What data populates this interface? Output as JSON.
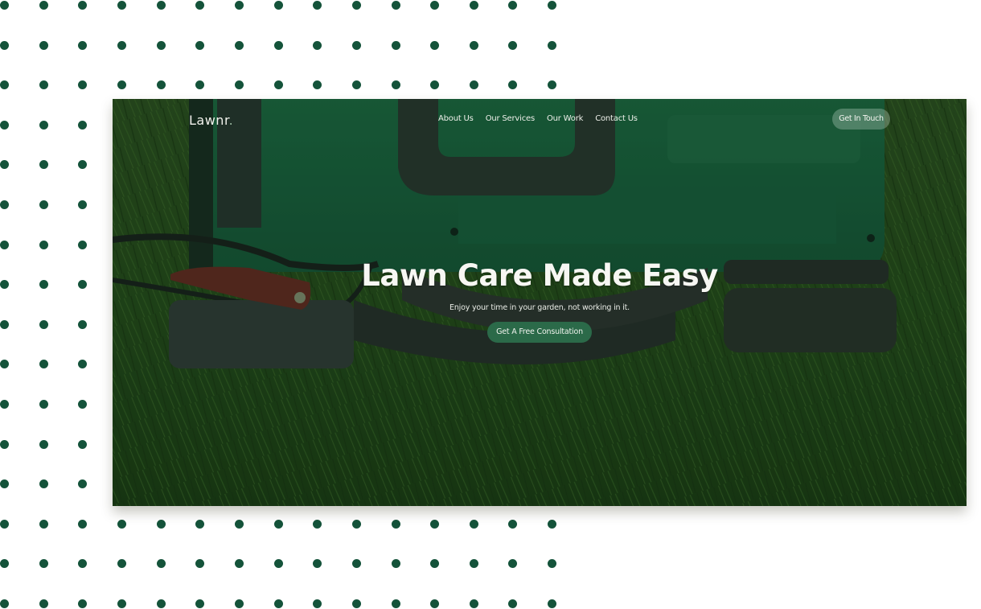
{
  "brand": {
    "name": "Lawnr",
    "dot": "."
  },
  "nav": {
    "links": [
      {
        "label": "About Us"
      },
      {
        "label": "Our Services"
      },
      {
        "label": "Our Work"
      },
      {
        "label": "Contact Us"
      }
    ],
    "cta_label": "Get In Touch"
  },
  "hero": {
    "title": "Lawn Care Made Easy",
    "subtitle": "Enjoy your time in your garden, not working in it.",
    "cta_label": "Get A Free Consultation",
    "image_description": "Top-down photo of a green lawn mower on grass"
  },
  "decor": {
    "dot_color": "#14533a",
    "dot_columns": 15,
    "dot_rows": 16
  },
  "colors": {
    "accent": "#2b6a49",
    "mower_green": "#1f6a45",
    "lever_red": "#6d2622"
  }
}
